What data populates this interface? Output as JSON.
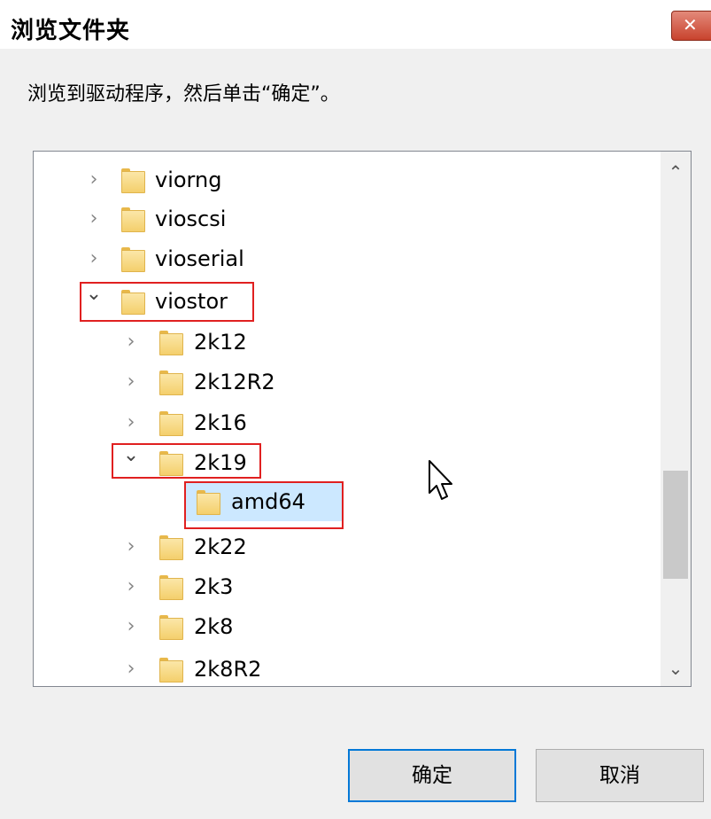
{
  "window": {
    "title": "浏览文件夹",
    "close_glyph": "✕"
  },
  "instruction": "浏览到驱动程序，然后单击“确定”。",
  "tree": {
    "rows": [
      {
        "label": "viorng",
        "expanded": false
      },
      {
        "label": "vioscsi",
        "expanded": false
      },
      {
        "label": "vioserial",
        "expanded": false
      },
      {
        "label": "viostor",
        "expanded": true
      },
      {
        "label": "2k12",
        "expanded": false
      },
      {
        "label": "2k12R2",
        "expanded": false
      },
      {
        "label": "2k16",
        "expanded": false
      },
      {
        "label": "2k19",
        "expanded": true
      },
      {
        "label": "amd64",
        "selected": true
      },
      {
        "label": "2k22",
        "expanded": false
      },
      {
        "label": "2k3",
        "expanded": false
      },
      {
        "label": "2k8",
        "expanded": false
      },
      {
        "label": "2k8R2",
        "expanded": false
      }
    ],
    "glyphs": {
      "collapsed": "›",
      "expanded": "⌄",
      "scroll_up": "⌃",
      "scroll_down": "⌄"
    }
  },
  "buttons": {
    "ok": "确定",
    "cancel": "取消"
  },
  "colors": {
    "highlight_box": "#e02020",
    "selection": "#cce8ff",
    "focus_border": "#0078d7"
  }
}
